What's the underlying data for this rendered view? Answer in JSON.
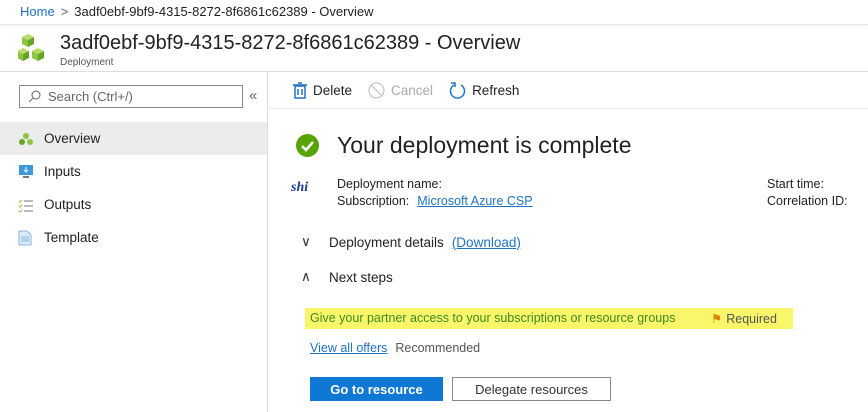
{
  "breadcrumb": {
    "home": "Home",
    "current": "3adf0ebf-9bf9-4315-8272-8f6861c62389 - Overview"
  },
  "header": {
    "title": "3adf0ebf-9bf9-4315-8272-8f6861c62389 - Overview",
    "subtitle": "Deployment"
  },
  "sidebar": {
    "search_placeholder": "Search (Ctrl+/)",
    "collapse": "«",
    "items": [
      {
        "label": "Overview"
      },
      {
        "label": "Inputs"
      },
      {
        "label": "Outputs"
      },
      {
        "label": "Template"
      }
    ]
  },
  "toolbar": {
    "delete": "Delete",
    "cancel": "Cancel",
    "refresh": "Refresh"
  },
  "main": {
    "status": "Your deployment is complete",
    "logo_text": "shi",
    "deployment_name_label": "Deployment name:",
    "subscription_label": "Subscription:",
    "subscription_value": "Microsoft Azure CSP",
    "start_time_label": "Start time:",
    "correlation_label": "Correlation ID:",
    "details": "Deployment details",
    "download": "(Download)",
    "next_steps": "Next steps",
    "partner_text": "Give your partner access to your subscriptions or resource groups",
    "required": "Required",
    "view_offers": "View all offers",
    "recommended": "Recommended",
    "go_button": "Go to resource",
    "delegate_button": "Delegate resources"
  }
}
